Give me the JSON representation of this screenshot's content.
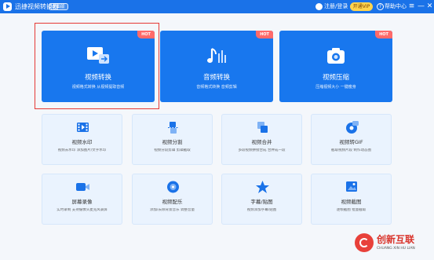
{
  "titlebar": {
    "app_title": "迅捷视频转换器",
    "app_tag": "桌面版",
    "login": "注册/登录",
    "vip": "开通VIP",
    "help": "帮助中心",
    "help_mark": "?",
    "menu_icon": "≡",
    "minimize_icon": "—",
    "close_icon": "✕"
  },
  "big_cards": [
    {
      "title": "视频转换",
      "subtitle": "视频格式转换 从视频提取音频",
      "badge": "HOT",
      "icon": "video-convert-icon"
    },
    {
      "title": "音频转换",
      "subtitle": "音频格式转换 音频剪辑",
      "badge": "HOT",
      "icon": "music-icon"
    },
    {
      "title": "视频压缩",
      "subtitle": "压缩视频大小 一键瘦身",
      "badge": "HOT",
      "icon": "camera-icon"
    }
  ],
  "small_cards": [
    {
      "title": "视频水印",
      "subtitle": "视频去水印 添加图片/文字水印",
      "icon": "film-icon"
    },
    {
      "title": "视频分割",
      "subtitle": "视频分段剪辑 剪辑截取",
      "icon": "split-icon"
    },
    {
      "title": "视频合并",
      "subtitle": "多段视频拼接合成 合并成一段",
      "icon": "merge-icon"
    },
    {
      "title": "视频转GIF",
      "subtitle": "截取视频片段 制作动态图",
      "icon": "gif-icon"
    },
    {
      "title": "屏幕录像",
      "subtitle": "实时录制 支持摄像头麦克风录屏",
      "icon": "camcorder-icon"
    },
    {
      "title": "视频配乐",
      "subtitle": "添加/去除背景音乐 调整音量",
      "icon": "music-disc-icon"
    },
    {
      "title": "字幕/贴图",
      "subtitle": "视频添加字幕/贴图",
      "icon": "star-icon"
    },
    {
      "title": "视频截图",
      "subtitle": "逐帧截图 批量截取",
      "icon": "screenshot-icon"
    }
  ],
  "watermark": {
    "text": "创新互联",
    "subtext": "CHUANG XIN HU LIAN"
  },
  "colors": {
    "titlebar": "#1a72e8",
    "big_card": "#1877ee",
    "hot_badge": "#ff6a6a",
    "vip": "#ffd44d",
    "small_card": "#eaf3fe",
    "highlight": "#e53935"
  }
}
